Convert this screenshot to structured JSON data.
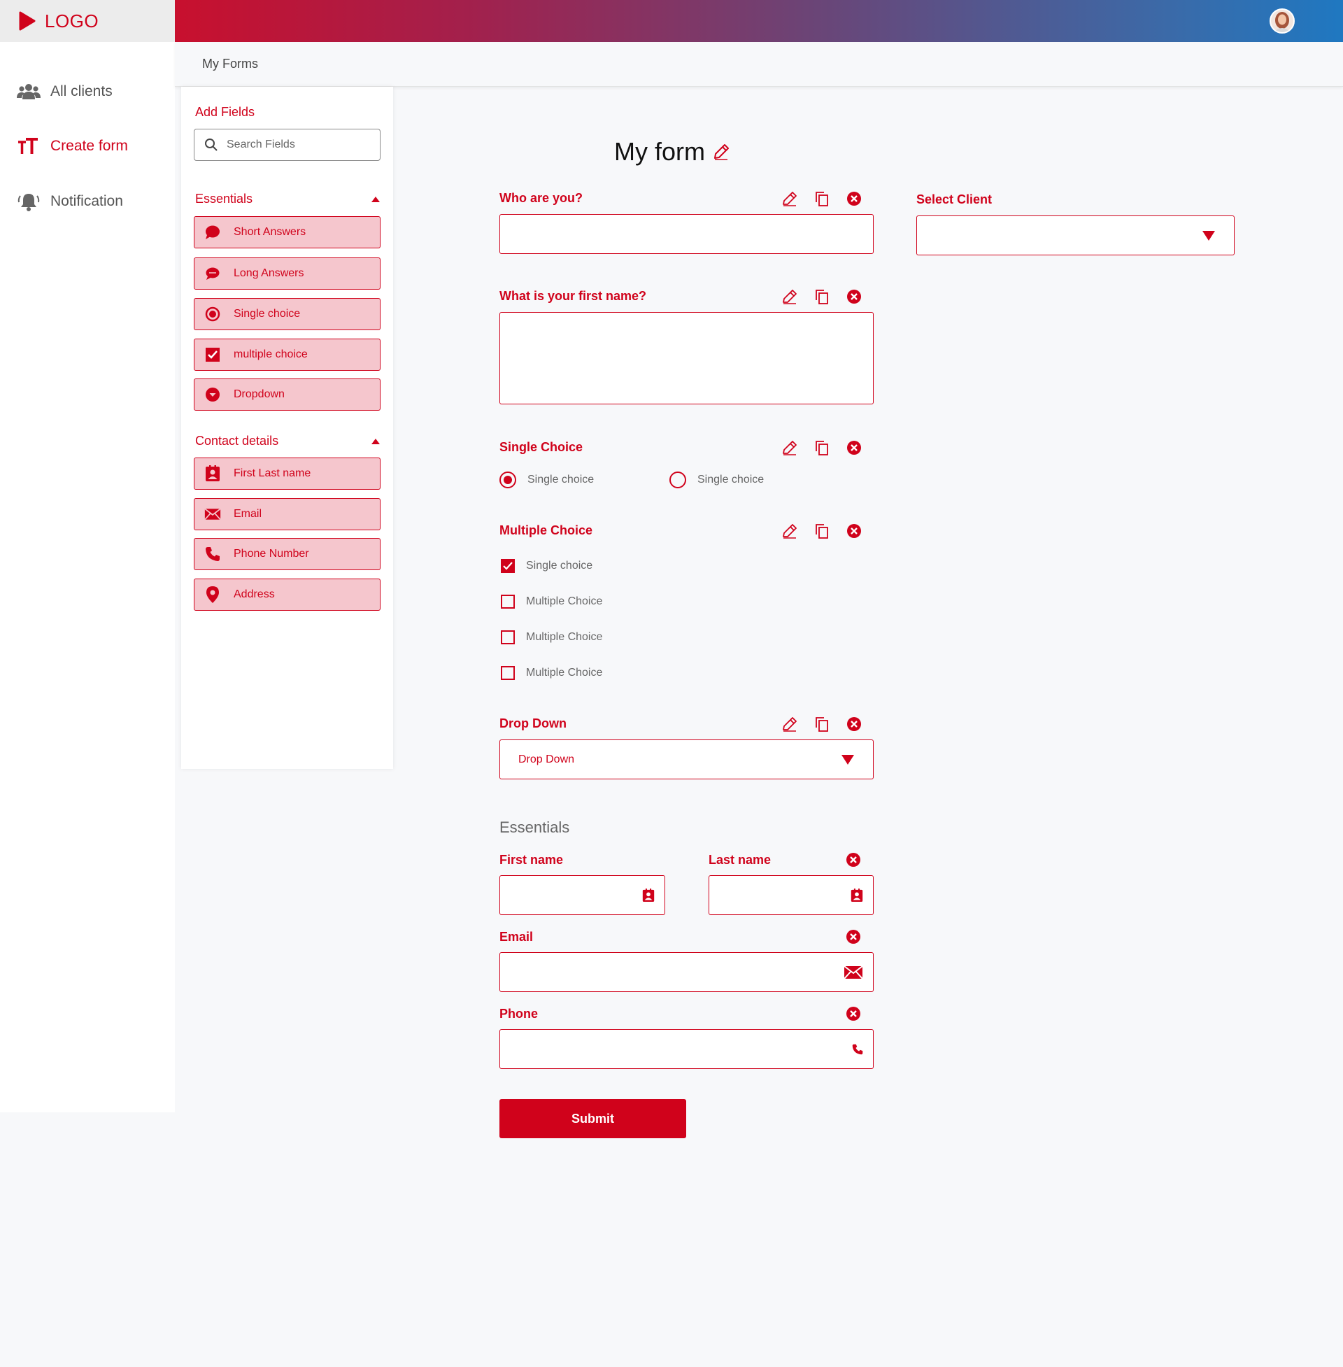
{
  "app": {
    "logo_text": "LOGO",
    "accent": "#d0021b"
  },
  "nav": {
    "items": [
      {
        "label": "All clients",
        "icon": "users-icon"
      },
      {
        "label": "Create form",
        "icon": "text-size-icon"
      },
      {
        "label": "Notification",
        "icon": "bell-icon"
      }
    ]
  },
  "breadcrumb": {
    "label": "My Forms"
  },
  "fields_panel": {
    "title": "Add Fields",
    "search_placeholder": "Search Fields",
    "essentials": {
      "title": "Essentials",
      "items": [
        "Short Answers",
        "Long Answers",
        "Single choice",
        "multiple choice",
        "Dropdown"
      ]
    },
    "contact": {
      "title": "Contact details",
      "items": [
        "First Last name",
        "Email",
        "Phone Number",
        "Address"
      ]
    }
  },
  "form": {
    "title": "My form",
    "q1_label": "Who are you?",
    "q2_label": "What is your first name?",
    "q3_label": "Single Choice",
    "q3_options": [
      "Single choice",
      "Single choice"
    ],
    "q4_label": "Multiple Choice",
    "q4_options": [
      "Single choice",
      "Multiple Choice",
      "Multiple Choice",
      "Multiple Choice"
    ],
    "q5_label": "Drop Down",
    "q5_value": "Drop Down",
    "select_client_label": "Select Client",
    "section_title": "Essentials",
    "first_name_label": "First name",
    "last_name_label": "Last name",
    "email_label": "Email",
    "phone_label": "Phone",
    "submit_label": "Submit"
  }
}
